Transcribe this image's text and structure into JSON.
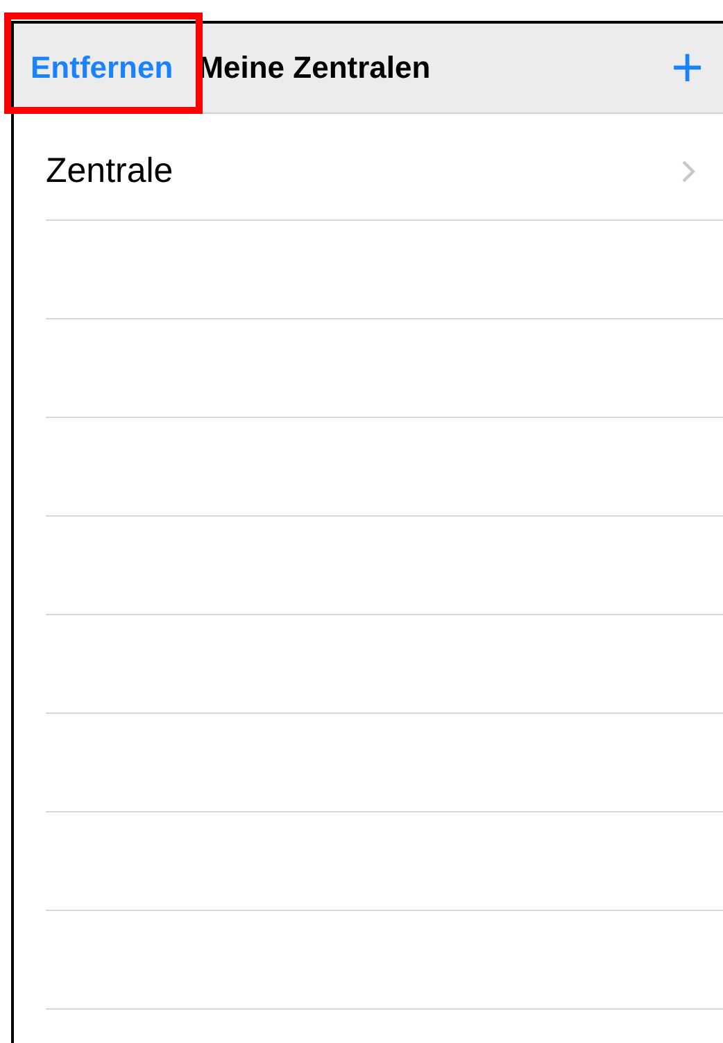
{
  "nav_bar": {
    "left_button": {
      "label": "Entfernen",
      "highlighted": true
    },
    "title": "Meine Zentralen",
    "right_button": {
      "label": "+"
    }
  },
  "rows": [
    {
      "label": "Zentrale",
      "disclosure": true
    }
  ]
}
